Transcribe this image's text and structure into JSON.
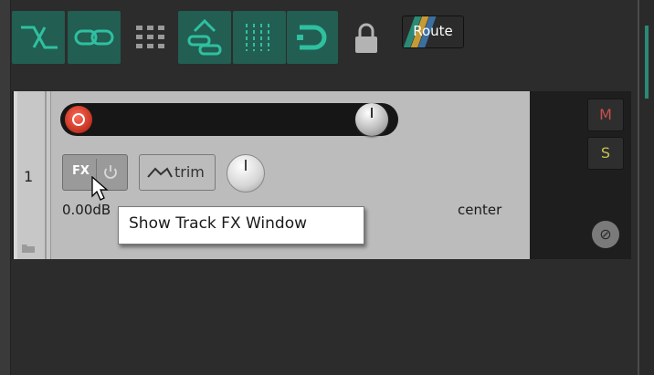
{
  "toolbar": {
    "buttons": [
      {
        "icon": "auto-crossfade-icon",
        "active": true
      },
      {
        "icon": "link-icon",
        "active": true
      },
      {
        "icon": "grid-icon",
        "active": false
      },
      {
        "icon": "ripple-edit-icon",
        "active": true
      },
      {
        "icon": "snap-grid-icon",
        "active": true
      },
      {
        "icon": "loop-icon",
        "active": true
      },
      {
        "icon": "lock-icon",
        "active": false
      }
    ],
    "accent": "#225e52",
    "icon_color": "#2fc0a0"
  },
  "track": {
    "number": "1",
    "route_label": "Route",
    "trim_label": "trim",
    "fx_label": "FX",
    "volume_readout": "0.00dB",
    "pan_readout": "center",
    "mute_label": "M",
    "solo_label": "S",
    "phase_symbol": "⊘",
    "colors": {
      "mute": "#c8504c",
      "solo": "#c7c14f",
      "record": "#c2311f"
    }
  },
  "tooltip": {
    "text": "Show Track FX Window"
  }
}
